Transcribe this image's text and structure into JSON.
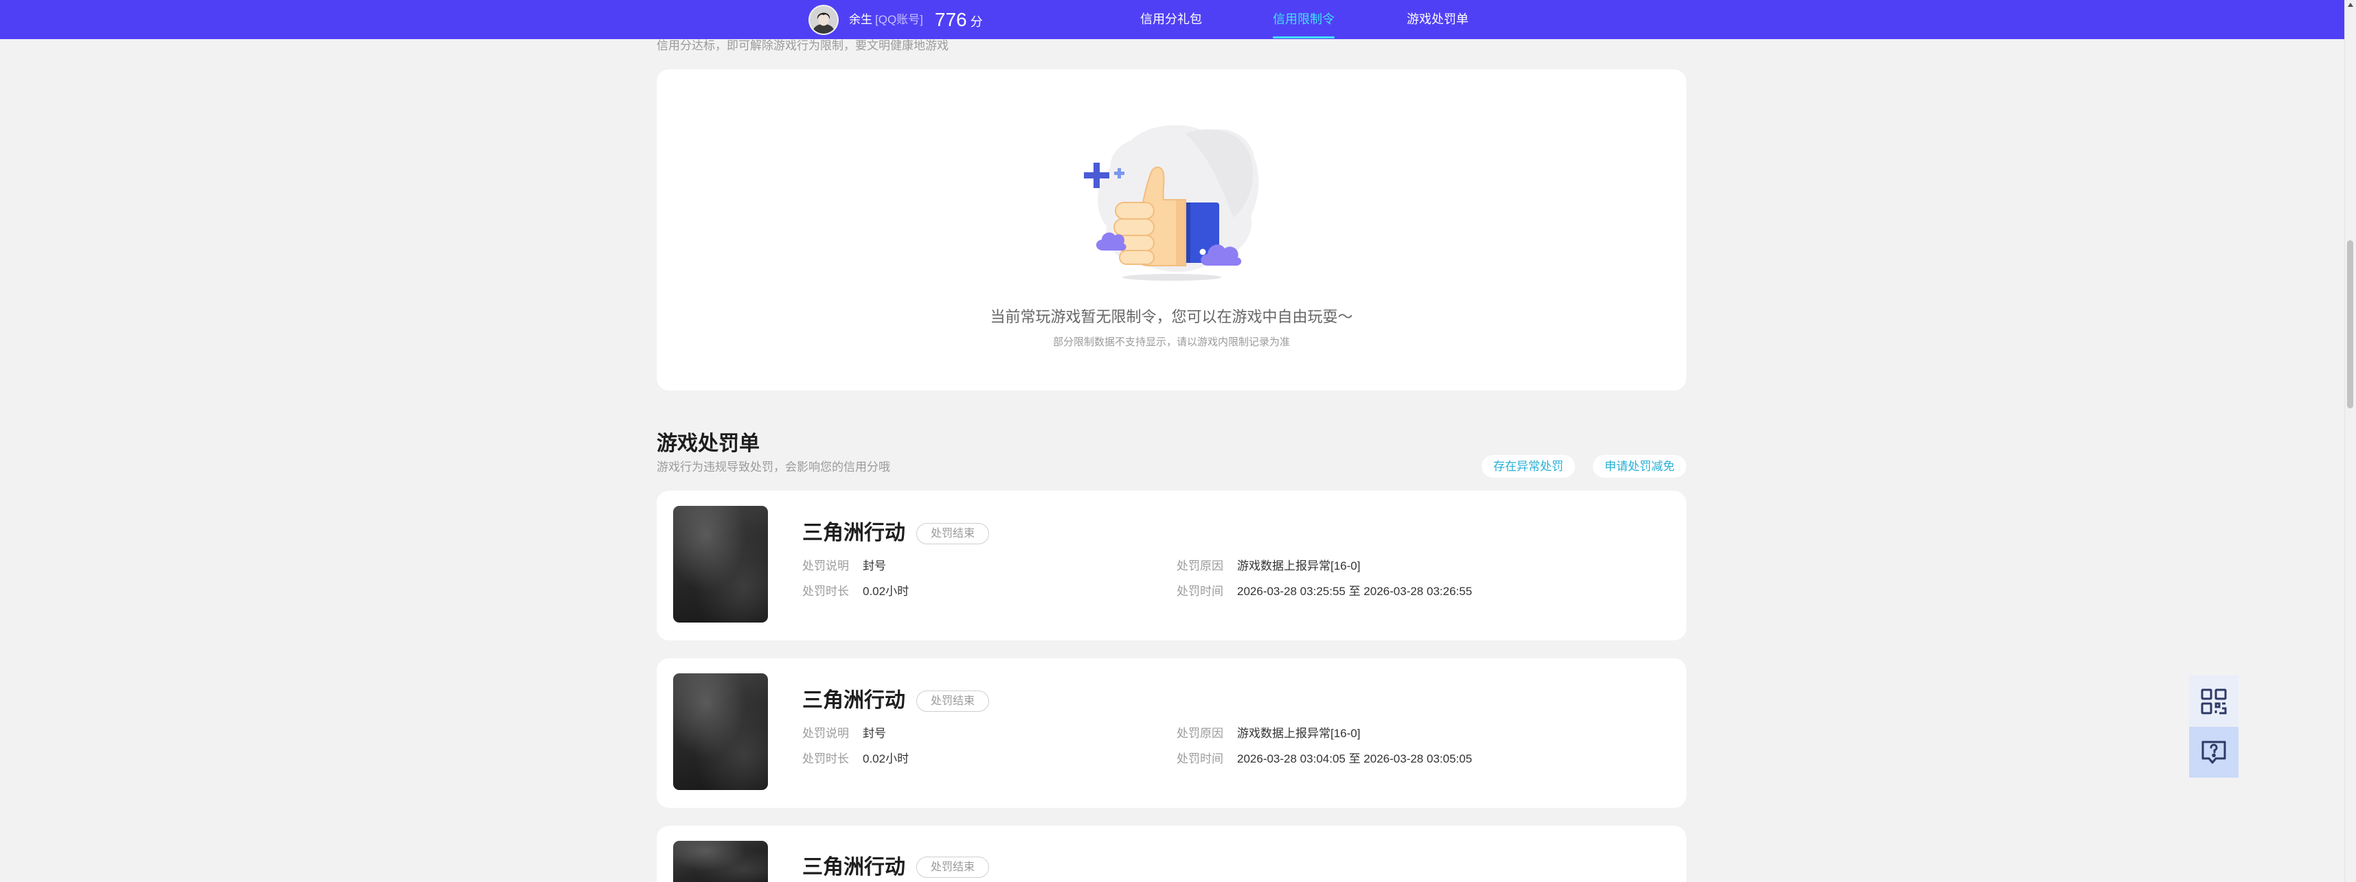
{
  "header": {
    "username": "余生",
    "account_type": "[QQ账号]",
    "score": "776",
    "score_unit": "分",
    "nav": [
      {
        "label": "信用分礼包",
        "active": false
      },
      {
        "label": "信用限制令",
        "active": true
      },
      {
        "label": "游戏处罚单",
        "active": false
      }
    ]
  },
  "restriction": {
    "subtitle": "信用分达标，即可解除游戏行为限制，要文明健康地游戏",
    "illustration": "thumbs-up-icon",
    "empty_text": "当前常玩游戏暂无限制令，您可以在游戏中自由玩耍～",
    "empty_note": "部分限制数据不支持显示，请以游戏内限制记录为准"
  },
  "penalty": {
    "title": "游戏处罚单",
    "subtitle": "游戏行为违规导致处罚，会影响您的信用分哦",
    "actions": [
      {
        "label": "存在异常处罚"
      },
      {
        "label": "申请处罚减免"
      }
    ],
    "labels": {
      "description": "处罚说明",
      "duration": "处罚时长",
      "reason": "处罚原因",
      "time": "处罚时间"
    },
    "items": [
      {
        "game": "三角洲行动",
        "status": "处罚结束",
        "description": "封号",
        "duration": "0.02小时",
        "reason": "游戏数据上报异常[16-0]",
        "time": "2026-03-28 03:25:55 至 2026-03-28 03:26:55"
      },
      {
        "game": "三角洲行动",
        "status": "处罚结束",
        "description": "封号",
        "duration": "0.02小时",
        "reason": "游戏数据上报异常[16-0]",
        "time": "2026-03-28 03:04:05 至 2026-03-28 03:05:05"
      },
      {
        "game": "三角洲行动",
        "status": "处罚结束"
      }
    ]
  },
  "floating_tools": [
    {
      "icon": "qrcode-icon"
    },
    {
      "icon": "question-chat-icon"
    }
  ],
  "colors": {
    "header_bg": "#5040f5",
    "accent": "#3fe3f5",
    "link": "#27b0d6",
    "page_bg": "#f2f2f3"
  }
}
